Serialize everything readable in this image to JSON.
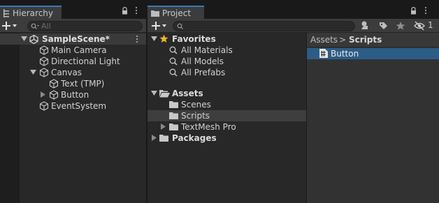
{
  "hierarchy": {
    "tab_label": "Hierarchy",
    "search_placeholder": "All",
    "scene": {
      "name": "SampleScene*"
    },
    "items": [
      {
        "label": "Main Camera",
        "icon": "gameobject-icon"
      },
      {
        "label": "Directional Light",
        "icon": "gameobject-icon"
      },
      {
        "label": "Canvas",
        "icon": "gameobject-icon",
        "expanded": true
      },
      {
        "label": "Text (TMP)",
        "icon": "gameobject-icon"
      },
      {
        "label": "Button",
        "icon": "gameobject-icon",
        "collapsed": true
      },
      {
        "label": "EventSystem",
        "icon": "gameobject-icon"
      }
    ]
  },
  "project": {
    "tab_label": "Project",
    "hidden_packages_count": "1",
    "tree": {
      "favorites": {
        "label": "Favorites",
        "items": [
          "All Materials",
          "All Models",
          "All Prefabs"
        ]
      },
      "assets": {
        "label": "Assets",
        "items": [
          "Scenes",
          "Scripts",
          "TextMesh Pro"
        ]
      },
      "packages": {
        "label": "Packages"
      }
    },
    "breadcrumb": {
      "root": "Assets",
      "separator": ">",
      "current": "Scripts"
    },
    "files": [
      {
        "name": "Button",
        "icon": "csharp-script-icon",
        "selected": true
      }
    ]
  },
  "colors": {
    "accent_tab": "#3a79bb",
    "selection_blue": "#2c5d87",
    "panel_bg": "#282828",
    "favorites_star": "#e8b52c"
  }
}
